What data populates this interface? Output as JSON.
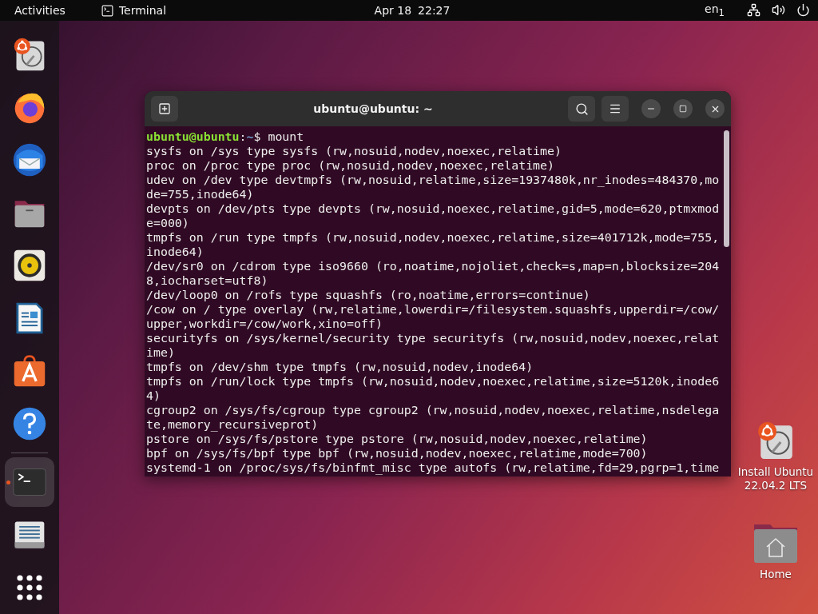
{
  "top_bar": {
    "activities": "Activities",
    "app": {
      "label": "Terminal"
    },
    "clock": {
      "date": "Apr 18",
      "time": "22:27"
    },
    "input_source": "en$_{1}$"
  },
  "dock": [
    {
      "kind": "installer",
      "running": false
    },
    {
      "kind": "firefox",
      "running": false
    },
    {
      "kind": "thunderbird",
      "running": false
    },
    {
      "kind": "files",
      "running": false
    },
    {
      "kind": "rhythmbox",
      "running": false
    },
    {
      "kind": "writer",
      "running": false
    },
    {
      "kind": "software",
      "running": false
    },
    {
      "kind": "help",
      "running": false
    },
    {
      "kind": "separator"
    },
    {
      "kind": "terminal",
      "running": true
    },
    {
      "kind": "text-editor",
      "running": false
    },
    {
      "kind": "apps-grid",
      "running": false
    }
  ],
  "terminal": {
    "title": "ubuntu@ubuntu: ~",
    "prompt": {
      "user_host": "ubuntu@ubuntu",
      "separator": ":",
      "path": "~",
      "symbol": "$",
      "command": "mount"
    },
    "lines": [
      "sysfs on /sys type sysfs (rw,nosuid,nodev,noexec,relatime)",
      "proc on /proc type proc (rw,nosuid,nodev,noexec,relatime)",
      "udev on /dev type devtmpfs (rw,nosuid,relatime,size=1937480k,nr_inodes=484370,mo",
      "de=755,inode64)",
      "devpts on /dev/pts type devpts (rw,nosuid,noexec,relatime,gid=5,mode=620,ptmxmod",
      "e=000)",
      "tmpfs on /run type tmpfs (rw,nosuid,nodev,noexec,relatime,size=401712k,mode=755,",
      "inode64)",
      "/dev/sr0 on /cdrom type iso9660 (ro,noatime,nojoliet,check=s,map=n,blocksize=204",
      "8,iocharset=utf8)",
      "/dev/loop0 on /rofs type squashfs (ro,noatime,errors=continue)",
      "/cow on / type overlay (rw,relatime,lowerdir=/filesystem.squashfs,upperdir=/cow/",
      "upper,workdir=/cow/work,xino=off)",
      "securityfs on /sys/kernel/security type securityfs (rw,nosuid,nodev,noexec,relat",
      "ime)",
      "tmpfs on /dev/shm type tmpfs (rw,nosuid,nodev,inode64)",
      "tmpfs on /run/lock type tmpfs (rw,nosuid,nodev,noexec,relatime,size=5120k,inode6",
      "4)",
      "cgroup2 on /sys/fs/cgroup type cgroup2 (rw,nosuid,nodev,noexec,relatime,nsdelega",
      "te,memory_recursiveprot)",
      "pstore on /sys/fs/pstore type pstore (rw,nosuid,nodev,noexec,relatime)",
      "bpf on /sys/fs/bpf type bpf (rw,nosuid,nodev,noexec,relatime,mode=700)",
      "systemd-1 on /proc/sys/fs/binfmt_misc type autofs (rw,relatime,fd=29,pgrp=1,time"
    ]
  },
  "desktop_icons": [
    {
      "kind": "installer",
      "label": "Install Ubuntu 22.04.2 LTS"
    },
    {
      "kind": "home",
      "label": "Home"
    }
  ]
}
